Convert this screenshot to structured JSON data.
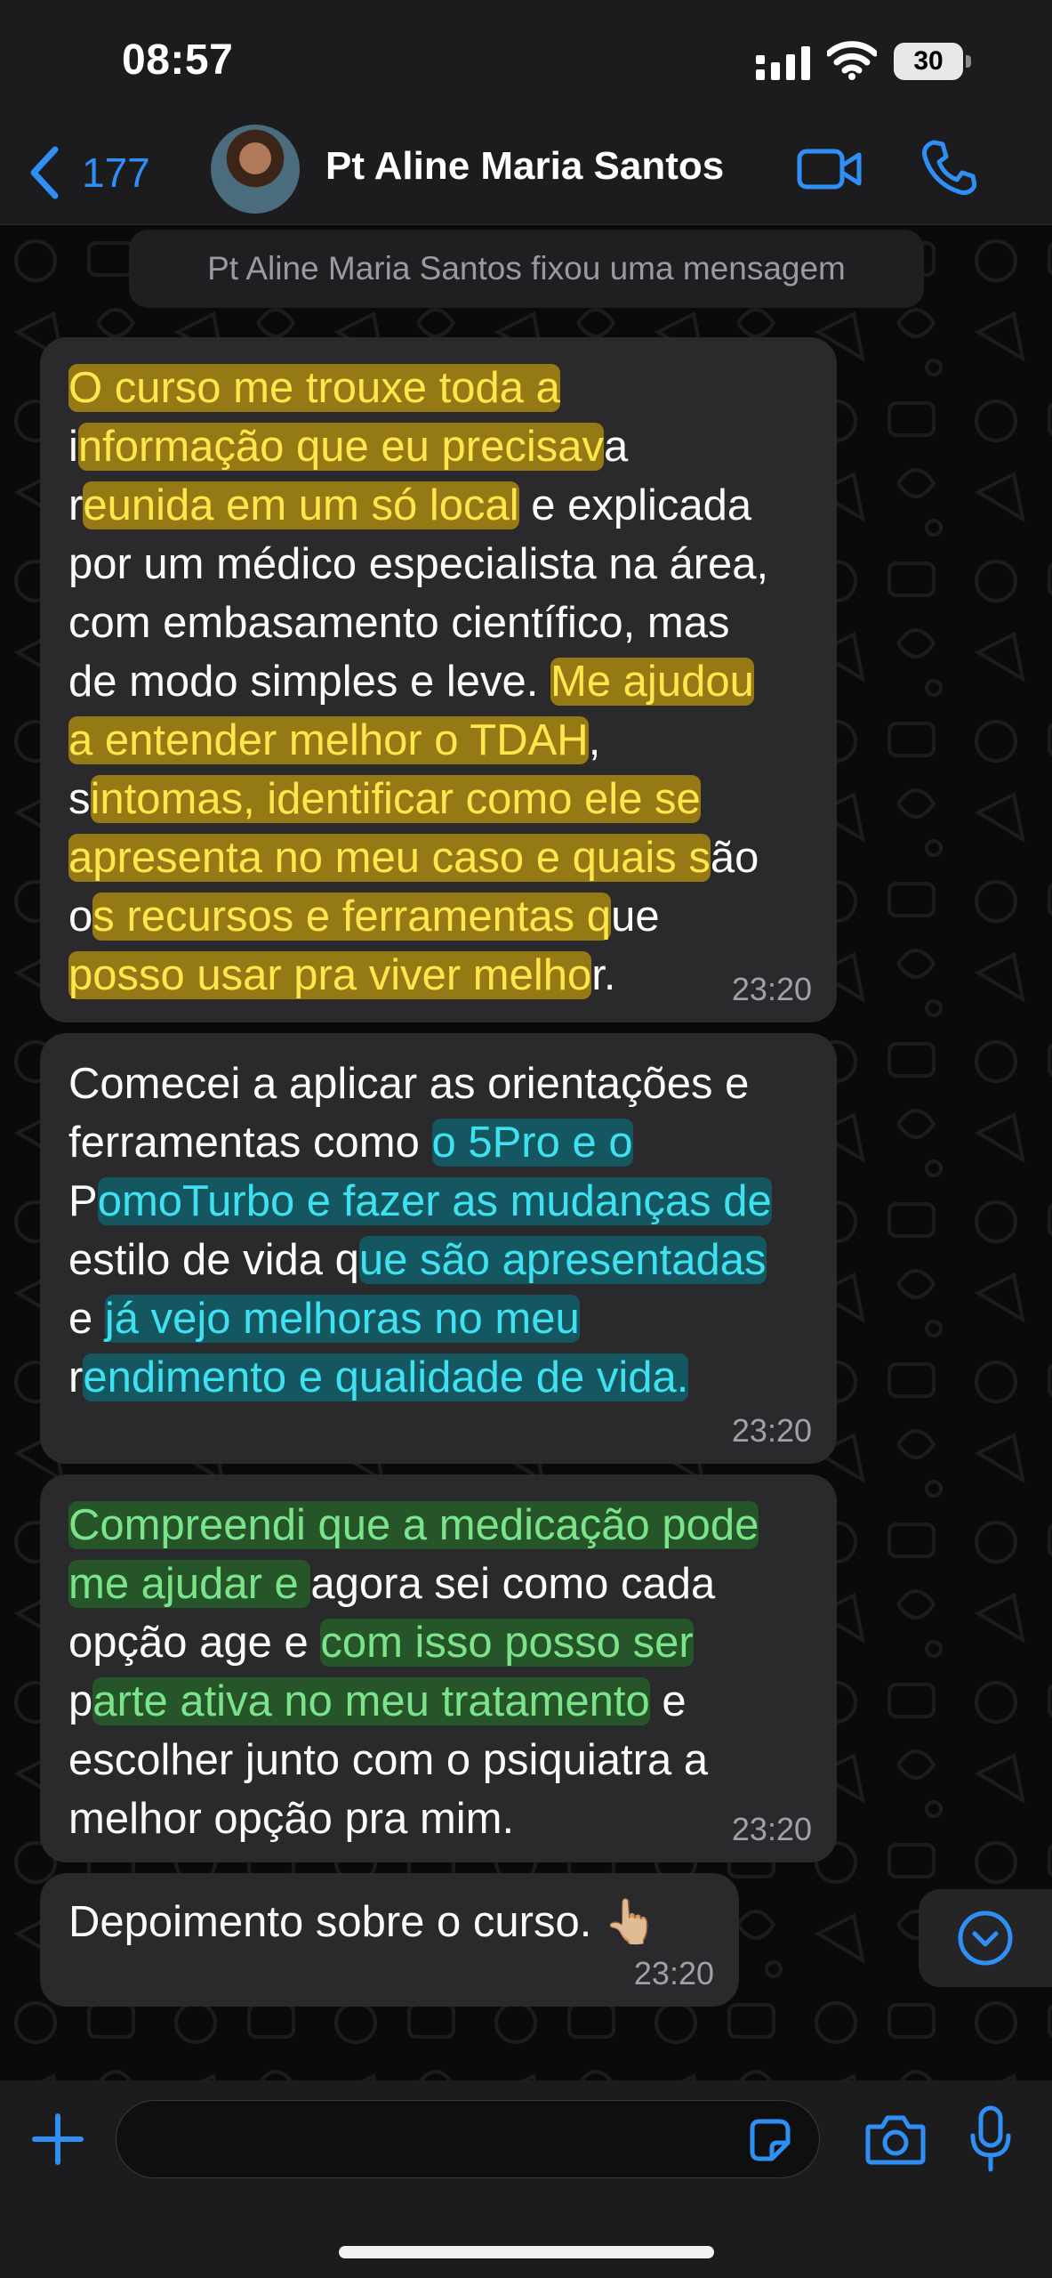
{
  "status_bar": {
    "time": "08:57",
    "battery": "30"
  },
  "header": {
    "back_count": "177",
    "contact_name": "Pt Aline Maria Santos"
  },
  "system_notice": "Pt Aline Maria Santos fixou uma mensagem",
  "messages": [
    {
      "time": "23:20",
      "lines": [
        [
          {
            "t": "O curso me trouxe toda a",
            "h": "y"
          }
        ],
        [
          {
            "t": "i"
          },
          {
            "t": "nformação que eu precisav",
            "h": "y"
          },
          {
            "t": "a"
          }
        ],
        [
          {
            "t": "r"
          },
          {
            "t": "eunida em um só local",
            "h": "y"
          },
          {
            "t": " e explicada"
          }
        ],
        [
          {
            "t": "por um médico especialista na área,"
          }
        ],
        [
          {
            "t": "com embasamento científico, mas"
          }
        ],
        [
          {
            "t": "de modo simples e leve. "
          },
          {
            "t": "Me ajudou",
            "h": "y"
          }
        ],
        [
          {
            "t": "a entender melhor o TDAH",
            "h": "y"
          },
          {
            "t": ","
          }
        ],
        [
          {
            "t": "s"
          },
          {
            "t": "intomas, identificar como ele se",
            "h": "y"
          }
        ],
        [
          {
            "t": "apresenta no meu caso e quais s",
            "h": "y"
          },
          {
            "t": "ão"
          }
        ],
        [
          {
            "t": "o"
          },
          {
            "t": "s recursos e ferramentas q",
            "h": "y"
          },
          {
            "t": "ue"
          }
        ],
        [
          {
            "t": "posso usar pra viver melho",
            "h": "y"
          },
          {
            "t": "r."
          }
        ]
      ]
    },
    {
      "time": "23:20",
      "lines": [
        [
          {
            "t": "Comecei a aplicar as orientações e"
          }
        ],
        [
          {
            "t": "ferramentas como "
          },
          {
            "t": "o 5Pro e o",
            "h": "b"
          }
        ],
        [
          {
            "t": "P"
          },
          {
            "t": "omoTurbo e fazer as mudanças de",
            "h": "b"
          }
        ],
        [
          {
            "t": "estilo de vida q"
          },
          {
            "t": "ue são apresentadas",
            "h": "b"
          }
        ],
        [
          {
            "t": "e "
          },
          {
            "t": "já vejo melhoras no meu",
            "h": "b"
          }
        ],
        [
          {
            "t": "r"
          },
          {
            "t": "endimento e qualidade de vida.",
            "h": "b"
          }
        ]
      ]
    },
    {
      "time": "23:20",
      "lines": [
        [
          {
            "t": "Compreendi que a medicação pode",
            "h": "g"
          }
        ],
        [
          {
            "t": "me ajudar e ",
            "h": "g"
          },
          {
            "t": "agora sei como cada"
          }
        ],
        [
          {
            "t": "opção age e "
          },
          {
            "t": "com isso posso ser",
            "h": "g"
          }
        ],
        [
          {
            "t": "p"
          },
          {
            "t": "arte ativa no meu tratamento",
            "h": "g"
          },
          {
            "t": " e"
          }
        ],
        [
          {
            "t": "escolher junto com o psiquiatra a"
          }
        ],
        [
          {
            "t": "melhor opção pra mim."
          }
        ]
      ]
    },
    {
      "time": "23:20",
      "lines": [
        [
          {
            "t": "Depoimento sobre o curso. 👆🏼"
          }
        ]
      ]
    }
  ],
  "input": {
    "value": "",
    "placeholder": ""
  },
  "icons": {
    "back": "chevron-left-icon",
    "video": "video-camera-icon",
    "call": "phone-icon",
    "scroll": "chevron-down-circle-icon",
    "plus": "plus-icon",
    "sticker": "sticker-icon",
    "camera": "camera-icon",
    "mic": "microphone-icon"
  },
  "colors": {
    "accent": "#2f8ff5",
    "bubble": "#2a2a2c",
    "header": "#1c1c1e",
    "highlight_yellow": "#ffe64d",
    "highlight_cyan": "#3fe1f0",
    "highlight_green": "#7be38a"
  }
}
